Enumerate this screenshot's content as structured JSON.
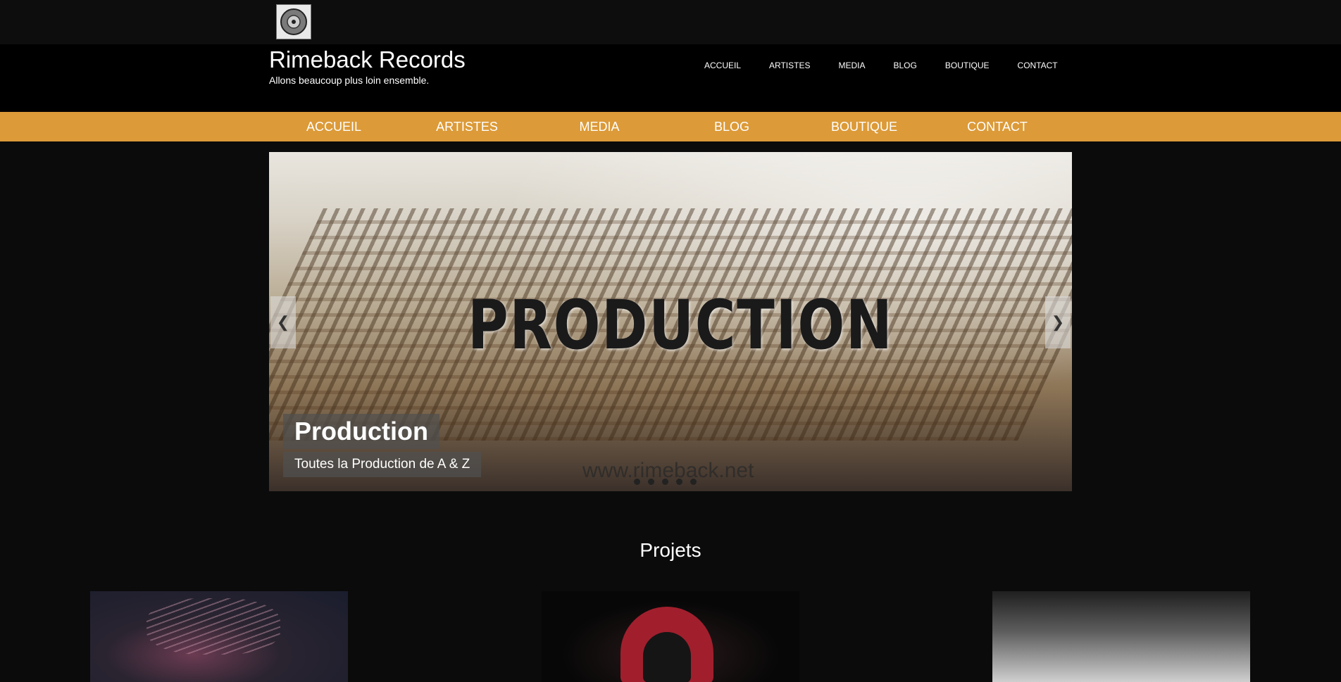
{
  "header": {
    "site_title": "Rimeback Records",
    "tagline": "Allons beaucoup plus loin ensemble."
  },
  "top_nav": [
    "ACCUEIL",
    "ARTISTES",
    "MEDIA",
    "BLOG",
    "BOUTIQUE",
    "CONTACT"
  ],
  "main_nav": [
    "ACCUEIL",
    "ARTISTES",
    "MEDIA",
    "BLOG",
    "BOUTIQUE",
    "CONTACT"
  ],
  "slider": {
    "image_text": "PRODUCTION",
    "watermark": "www.rimeback.net",
    "caption_title": "Production",
    "caption_subtitle": "Toutes la Production de A & Z",
    "prev_icon": "chevron-left-icon",
    "next_icon": "chevron-right-icon",
    "slide_count": 5
  },
  "projects": {
    "title": "Projets"
  },
  "colors": {
    "background": "#0b0b0b",
    "header": "#000000",
    "accent": "#dc9a38"
  }
}
